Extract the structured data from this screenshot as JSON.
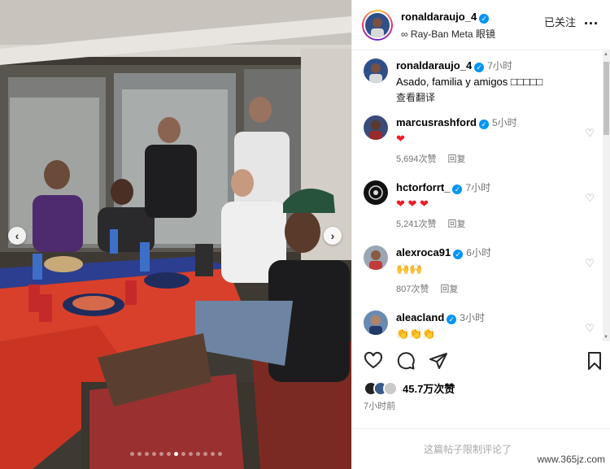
{
  "header": {
    "username": "ronaldaraujo_4",
    "subtitle_icon": "glasses-icon",
    "subtitle": "Ray-Ban Meta 眼镜",
    "follow_label": "已关注",
    "more_label": "..."
  },
  "caption": {
    "username": "ronaldaraujo_4",
    "time": "7小时",
    "text": "Asado, familia y amigos □□□□□",
    "translate_label": "查看翻译"
  },
  "comments": [
    {
      "username": "marcusrashford",
      "time": "5小时",
      "text": "❤",
      "likes": "5,694次赞",
      "reply": "回复"
    },
    {
      "username": "hctorforrt_",
      "time": "7小时",
      "text": "❤ ❤ ❤",
      "likes": "5,241次赞",
      "reply": "回复"
    },
    {
      "username": "alexroca91",
      "time": "6小时",
      "text": "🙌🙌",
      "likes": "807次赞",
      "reply": "回复"
    },
    {
      "username": "aleacland",
      "time": "3小时",
      "text": "👏👏👏",
      "likes": "",
      "reply": ""
    }
  ],
  "actions": {
    "like_icon": "heart-icon",
    "comment_icon": "comment-icon",
    "share_icon": "share-icon",
    "save_icon": "bookmark-icon"
  },
  "likes_total": "45.7万次赞",
  "posted_ago": "7小时前",
  "comments_limited": "这篇帖子限制评论了",
  "watermark": "www.365jz.com",
  "carousel": {
    "total": 13,
    "active_index": 6
  },
  "colors": {
    "verified": "#0095f6",
    "heart": "#ed1c24",
    "muted": "#737373"
  }
}
